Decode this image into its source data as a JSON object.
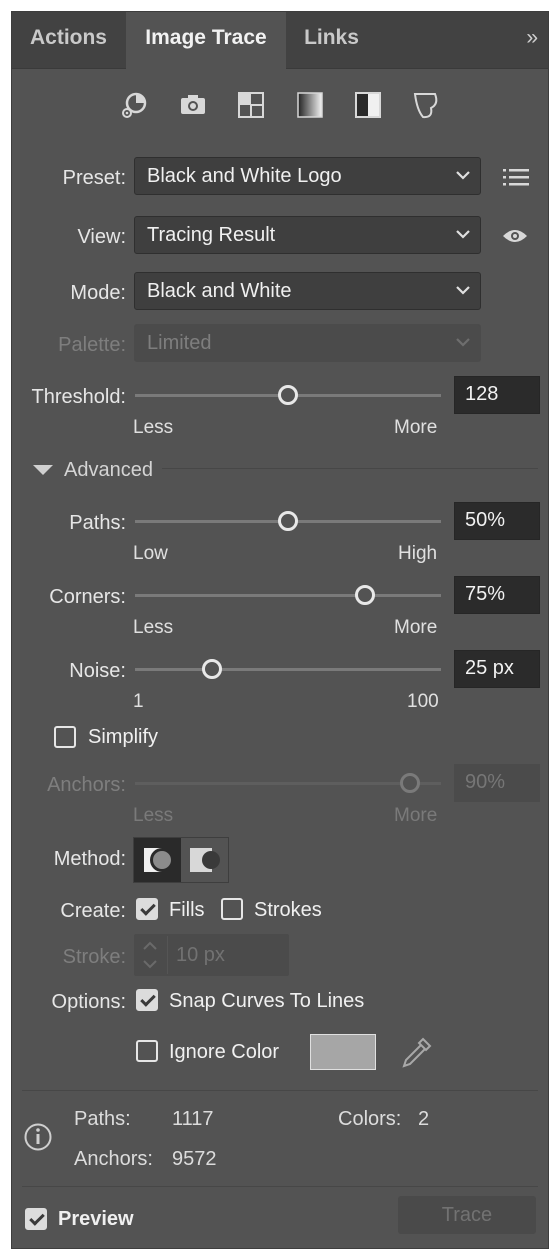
{
  "tabs": [
    "Actions",
    "Image Trace",
    "Links"
  ],
  "active_tab": "Image Trace",
  "tab_collapse_glyph": "»",
  "toolbar_icons": [
    "auto-color-icon",
    "high-color-icon",
    "low-color-icon",
    "grayscale-icon",
    "black-and-white-icon",
    "outline-icon"
  ],
  "preset": {
    "label": "Preset:",
    "value": "Black and White Logo"
  },
  "view": {
    "label": "View:",
    "value": "Tracing Result"
  },
  "mode": {
    "label": "Mode:",
    "value": "Black and White"
  },
  "palette": {
    "label": "Palette:",
    "value": "Limited"
  },
  "threshold": {
    "label": "Threshold:",
    "value": "128",
    "level": 0.5,
    "min_label": "Less",
    "max_label": "More"
  },
  "advanced": {
    "label": "Advanced"
  },
  "paths": {
    "label": "Paths:",
    "value": "50%",
    "level": 0.5,
    "min_label": "Low",
    "max_label": "High"
  },
  "corners": {
    "label": "Corners:",
    "value": "75%",
    "level": 0.75,
    "min_label": "Less",
    "max_label": "More"
  },
  "noise": {
    "label": "Noise:",
    "value": "25 px",
    "level": 0.25,
    "min_label": "1",
    "max_label": "100"
  },
  "simplify": {
    "label": "Simplify",
    "checked": false
  },
  "anchors": {
    "label": "Anchors:",
    "value": "90%",
    "level": 0.9,
    "min_label": "Less",
    "max_label": "More"
  },
  "method": {
    "label": "Method:",
    "options": [
      "abutting",
      "overlapping"
    ],
    "selected": "abutting"
  },
  "create": {
    "label": "Create:",
    "fills_label": "Fills",
    "fills_checked": true,
    "strokes_label": "Strokes",
    "strokes_checked": false
  },
  "stroke": {
    "label": "Stroke:",
    "value": "10 px"
  },
  "options": {
    "label": "Options:",
    "snap_label": "Snap Curves To Lines",
    "snap_checked": true,
    "ignore_label": "Ignore Color",
    "ignore_checked": false,
    "ignore_color_swatch": "#a6a6a6"
  },
  "stats": {
    "paths_label": "Paths:",
    "paths_value": "1117",
    "colors_label": "Colors:",
    "colors_value": "2",
    "anchors_label": "Anchors:",
    "anchors_value": "9572"
  },
  "preview": {
    "label": "Preview",
    "checked": true
  },
  "trace_button": "Trace",
  "colors": {
    "panel_bg": "#535353",
    "tab_bar_bg": "#424242",
    "field_bg": "#2b2b2b"
  }
}
